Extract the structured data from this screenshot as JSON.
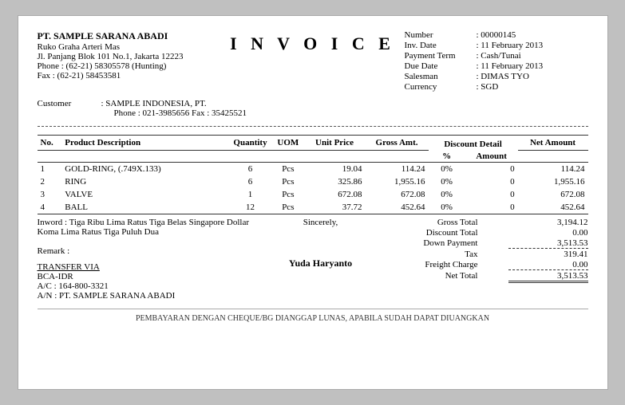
{
  "company": {
    "name": "PT. SAMPLE SARANA ABADI",
    "address1": "Ruko Graha Arteri Mas",
    "address2": "Jl. Panjang Blok 101 No.1, Jakarta 12223",
    "phone": "Phone  :  (62-21) 58305578 (Hunting)",
    "fax": "Fax      :  (62-21) 58453581"
  },
  "invoice_title": "I N V O I C E",
  "meta": {
    "number_label": "Number",
    "number_value": ": 00000145",
    "inv_date_label": "Inv. Date",
    "inv_date_value": ": 11 February 2013",
    "payment_term_label": "Payment Term",
    "payment_term_value": ": Cash/Tunai",
    "due_date_label": "Due Date",
    "due_date_value": ": 11 February 2013",
    "salesman_label": "Salesman",
    "salesman_value": ": DIMAS TYO",
    "currency_label": "Currency",
    "currency_value": ": SGD"
  },
  "customer": {
    "label": "Customer",
    "name": ": SAMPLE  INDONESIA, PT.",
    "contact": "Phone : 021-3985656   Fax : 35425521"
  },
  "table": {
    "headers": {
      "no": "No.",
      "desc": "Product Description",
      "qty": "Quantity",
      "uom": "UOM",
      "unit_price": "Unit Price",
      "gross_amt": "Gross Amt.",
      "discount_detail": "Discount Detail",
      "disc_pct": "%",
      "disc_amt": "Amount",
      "net_amount": "Net Amount"
    },
    "items": [
      {
        "no": "1",
        "desc": "GOLD-RING, (.749X.133)",
        "qty": "6",
        "uom": "Pcs",
        "unit_price": "19.04",
        "gross_amt": "114.24",
        "disc_pct": "0%",
        "disc_amt": "0",
        "net_amount": "114.24"
      },
      {
        "no": "2",
        "desc": "RING",
        "qty": "6",
        "uom": "Pcs",
        "unit_price": "325.86",
        "gross_amt": "1,955.16",
        "disc_pct": "0%",
        "disc_amt": "0",
        "net_amount": "1,955.16"
      },
      {
        "no": "3",
        "desc": "VALVE",
        "qty": "1",
        "uom": "Pcs",
        "unit_price": "672.08",
        "gross_amt": "672.08",
        "disc_pct": "0%",
        "disc_amt": "0",
        "net_amount": "672.08"
      },
      {
        "no": "4",
        "desc": "BALL",
        "qty": "12",
        "uom": "Pcs",
        "unit_price": "37.72",
        "gross_amt": "452.64",
        "disc_pct": "0%",
        "disc_amt": "0",
        "net_amount": "452.64"
      }
    ]
  },
  "inword": {
    "label": "Inword :",
    "text": "Tiga Ribu Lima Ratus Tiga Belas Singapore Dollar Koma Lima Ratus Tiga Puluh Dua"
  },
  "sincerely": "Sincerely,",
  "remark_label": "Remark :",
  "transfer": {
    "label": "TRANSFER VIA",
    "bank": "BCA-IDR",
    "account": "A/C : 164-800-3321",
    "an": "A/N : PT. SAMPLE SARANA ABADI"
  },
  "signatory": "Yuda  Haryanto",
  "totals": {
    "gross_total_label": "Gross Total",
    "gross_total_value": "3,194.12",
    "discount_total_label": "Discount Total",
    "discount_total_value": "0.00",
    "down_payment_label": "Down Payment",
    "down_payment_value": "3,513.53",
    "tax_label": "Tax",
    "tax_value": "319.41",
    "freight_label": "Freight Charge",
    "freight_value": "0.00",
    "net_total_label": "Net Total",
    "net_total_value": "3,513.53"
  },
  "footer_note": "PEMBAYARAN DENGAN CHEQUE/BG DIANGGAP LUNAS, APABILA SUDAH DAPAT DIUANGKAN"
}
